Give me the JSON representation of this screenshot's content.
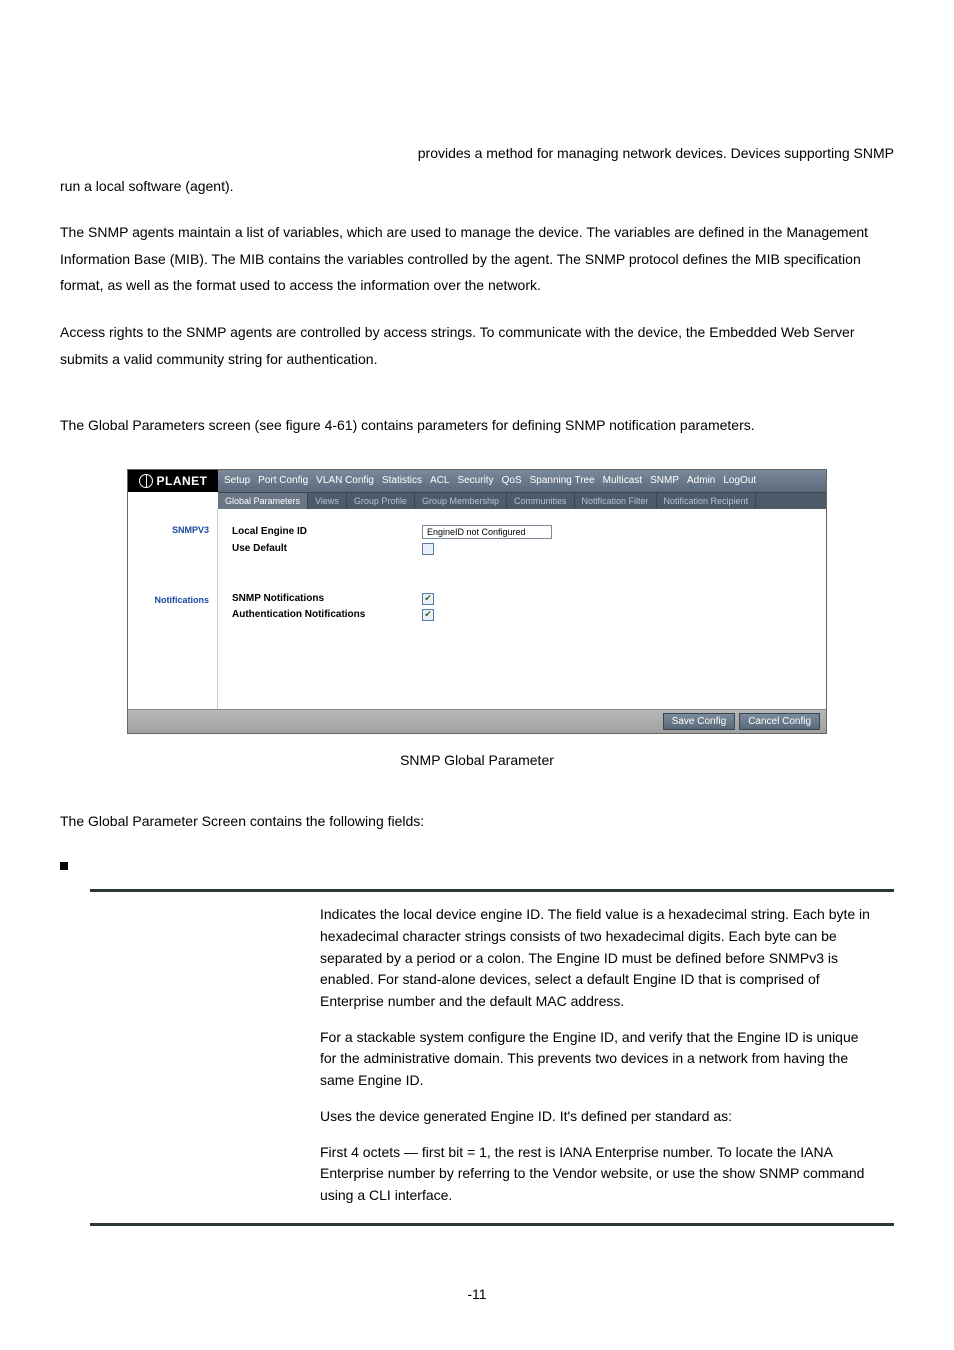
{
  "intro": {
    "frag1": "provides a method for managing network devices. Devices supporting SNMP",
    "frag2": "run a local software (agent).",
    "para2": "The SNMP agents maintain a list of variables, which are used to manage the device. The variables are defined in the Management Information Base (MIB). The MIB contains the variables controlled by the agent. The SNMP protocol defines the MIB specification format, as well as the format used to access the information over the network.",
    "para3": "Access rights to the SNMP agents are controlled by access strings. To communicate with the device, the Embedded Web Server submits a valid community string for authentication.",
    "para4": "The Global Parameters screen (see figure 4-61) contains parameters for defining SNMP notification parameters."
  },
  "screenshot": {
    "logo_text": "PLANET",
    "menu": [
      "Setup",
      "Port Config",
      "VLAN Config",
      "Statistics",
      "ACL",
      "Security",
      "QoS",
      "Spanning Tree",
      "Multicast",
      "SNMP",
      "Admin",
      "LogOut"
    ],
    "tabs": [
      "Global Parameters",
      "Views",
      "Group Profile",
      "Group Membership",
      "Communities",
      "Notification Filter",
      "Notification Recipient"
    ],
    "side": {
      "section1": "SNMPV3",
      "section2": "Notifications"
    },
    "fields": {
      "local_engine_id_label": "Local Engine ID",
      "local_engine_id_value": "EngineID not Configured",
      "use_default_label": "Use Default",
      "use_default_checked": false,
      "snmp_notif_label": "SNMP Notifications",
      "snmp_notif_checked": true,
      "auth_notif_label": "Authentication Notifications",
      "auth_notif_checked": true
    },
    "buttons": {
      "save": "Save Config",
      "cancel": "Cancel Config"
    }
  },
  "caption": "SNMP Global Parameter",
  "after_caption": "The Global Parameter Screen contains the following fields:",
  "def": {
    "p1": "Indicates the local device engine ID. The field value is a hexadecimal string. Each byte in hexadecimal character strings consists of two hexadecimal digits. Each byte can be separated by a period or a colon. The Engine ID must be defined before SNMPv3 is enabled. For stand-alone devices, select a default Engine ID that is comprised of Enterprise number and the default MAC address.",
    "p2": "For a stackable system configure the Engine ID, and verify that the Engine ID is unique for the administrative domain. This prevents two devices in a network from having the same Engine ID.",
    "p3": "Uses the device generated Engine ID. It's defined per standard as:",
    "p4": "First 4 octets — first bit = 1, the rest is IANA Enterprise number. To locate the IANA Enterprise number by referring to the Vendor website, or use the show SNMP command using a CLI interface."
  },
  "page_number": "-11"
}
